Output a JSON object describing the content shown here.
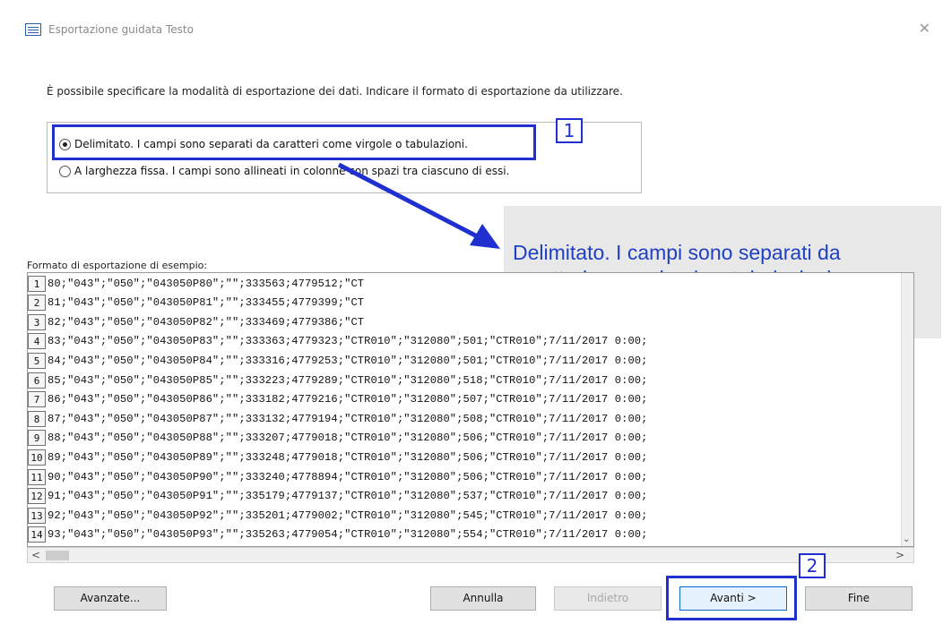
{
  "window": {
    "title": "Esportazione guidata Testo",
    "close_glyph": "✕"
  },
  "instruction": "È possibile specificare la modalità di esportazione dei dati. Indicare il formato di esportazione da utilizzare.",
  "options": [
    {
      "label": "Delimitato. I campi sono separati da caratteri come virgole o tabulazioni.",
      "selected": true
    },
    {
      "label": "A larghezza fissa. I campi sono allineati in colonne con spazi tra ciascuno di essi.",
      "selected": false
    }
  ],
  "annotations": {
    "badge_1": "1",
    "badge_2": "2",
    "callout_line1": "Delimitato. I campi sono separati da",
    "callout_line2": "caratteri come virgole o tabulazioni",
    "color": "#1f2fd0"
  },
  "preview": {
    "label": "Formato di esportazione di esempio:",
    "rows": [
      {
        "n": "1",
        "text": "80;\"043\";\"050\";\"043050P80\";\"\";333563;4779512;\"CT"
      },
      {
        "n": "2",
        "text": "81;\"043\";\"050\";\"043050P81\";\"\";333455;4779399;\"CT"
      },
      {
        "n": "3",
        "text": "82;\"043\";\"050\";\"043050P82\";\"\";333469;4779386;\"CT"
      },
      {
        "n": "4",
        "text": "83;\"043\";\"050\";\"043050P83\";\"\";333363;4779323;\"CTR010\";\"312080\";501;\"CTR010\";7/11/2017 0:00;"
      },
      {
        "n": "5",
        "text": "84;\"043\";\"050\";\"043050P84\";\"\";333316;4779253;\"CTR010\";\"312080\";501;\"CTR010\";7/11/2017 0:00;"
      },
      {
        "n": "6",
        "text": "85;\"043\";\"050\";\"043050P85\";\"\";333223;4779289;\"CTR010\";\"312080\";518;\"CTR010\";7/11/2017 0:00;"
      },
      {
        "n": "7",
        "text": "86;\"043\";\"050\";\"043050P86\";\"\";333182;4779216;\"CTR010\";\"312080\";507;\"CTR010\";7/11/2017 0:00;"
      },
      {
        "n": "8",
        "text": "87;\"043\";\"050\";\"043050P87\";\"\";333132;4779194;\"CTR010\";\"312080\";508;\"CTR010\";7/11/2017 0:00;"
      },
      {
        "n": "9",
        "text": "88;\"043\";\"050\";\"043050P88\";\"\";333207;4779018;\"CTR010\";\"312080\";506;\"CTR010\";7/11/2017 0:00;"
      },
      {
        "n": "10",
        "text": "89;\"043\";\"050\";\"043050P89\";\"\";333248;4779018;\"CTR010\";\"312080\";506;\"CTR010\";7/11/2017 0:00;"
      },
      {
        "n": "11",
        "text": "90;\"043\";\"050\";\"043050P90\";\"\";333240;4778894;\"CTR010\";\"312080\";506;\"CTR010\";7/11/2017 0:00;"
      },
      {
        "n": "12",
        "text": "91;\"043\";\"050\";\"043050P91\";\"\";335179;4779137;\"CTR010\";\"312080\";537;\"CTR010\";7/11/2017 0:00;"
      },
      {
        "n": "13",
        "text": "92;\"043\";\"050\";\"043050P92\";\"\";335201;4779002;\"CTR010\";\"312080\";545;\"CTR010\";7/11/2017 0:00;"
      },
      {
        "n": "14",
        "text": "93;\"043\";\"050\";\"043050P93\";\"\";335263;4779054;\"CTR010\";\"312080\";554;\"CTR010\";7/11/2017 0:00;"
      }
    ]
  },
  "buttons": {
    "advanced": "Avanzate...",
    "cancel": "Annulla",
    "back": "Indietro",
    "next": "Avanti >",
    "finish": "Fine"
  }
}
